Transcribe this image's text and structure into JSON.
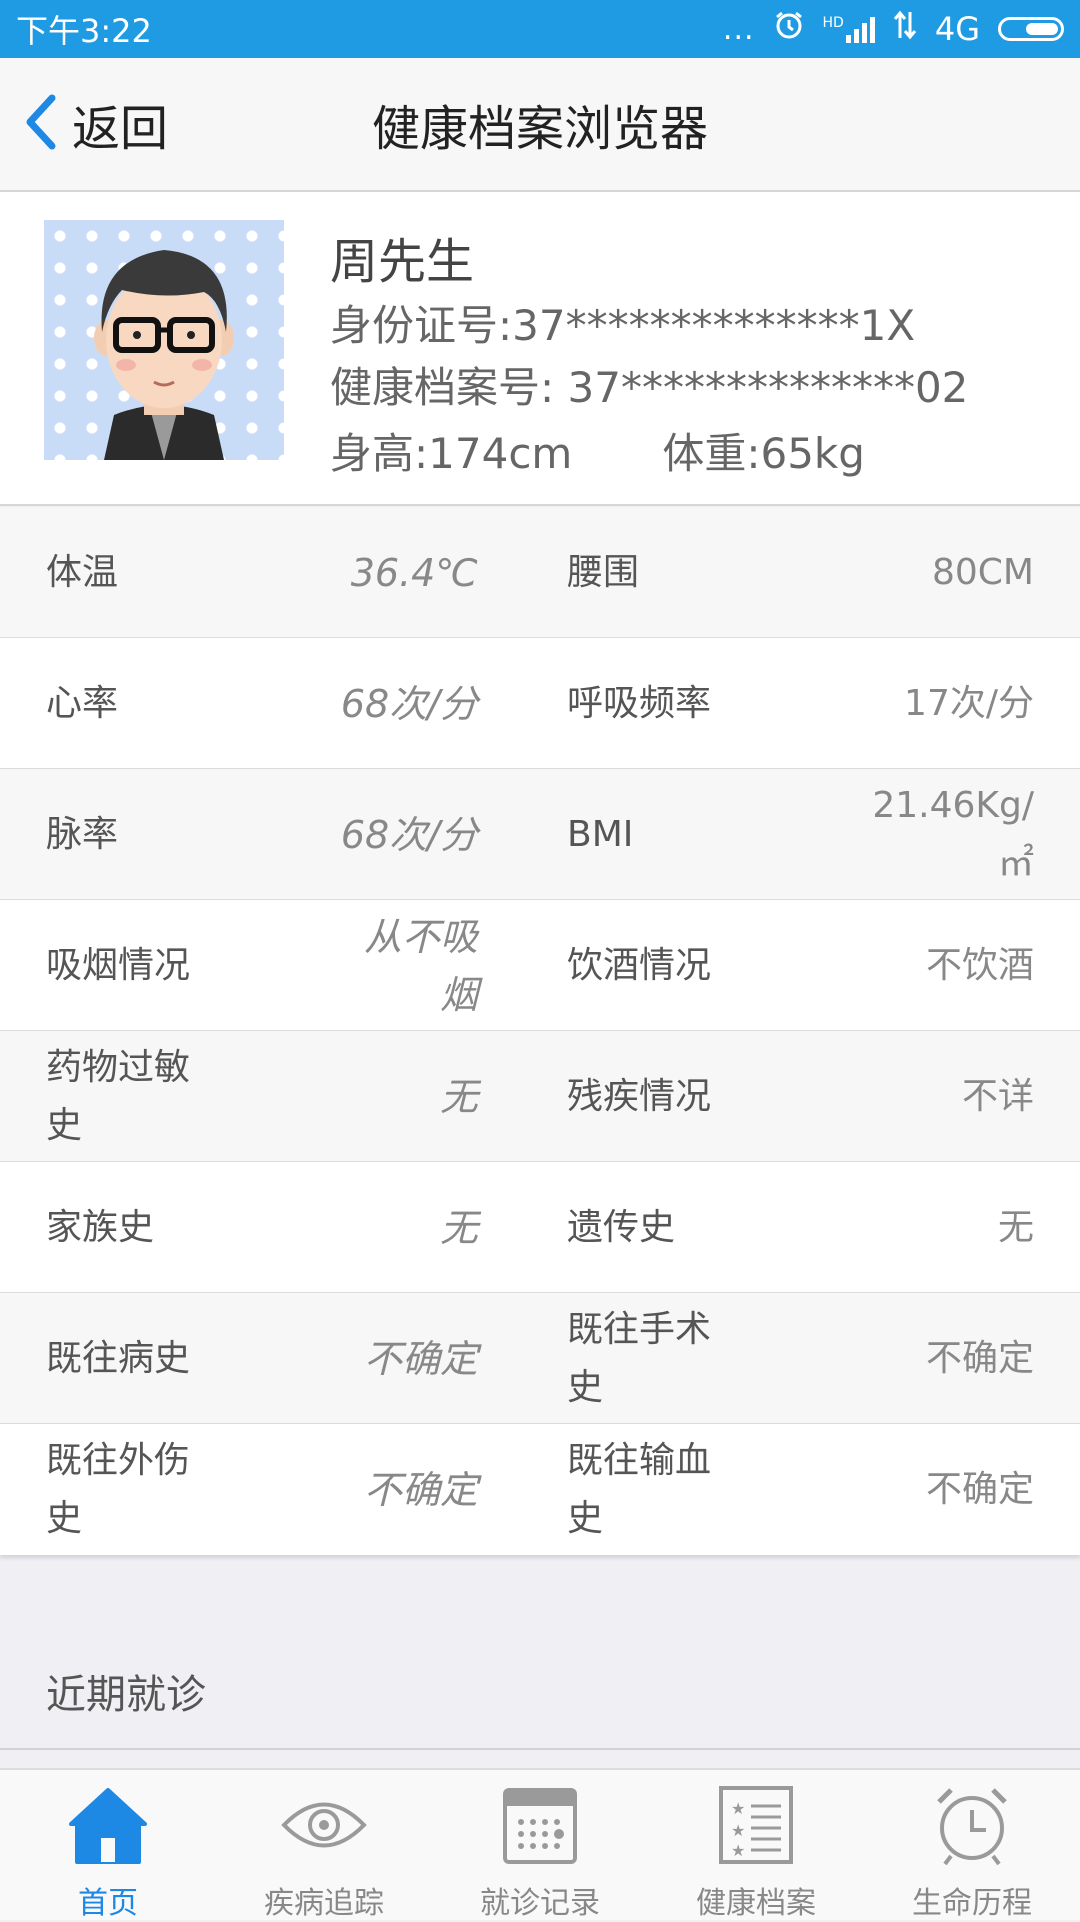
{
  "status_bar": {
    "time": "下午3:22",
    "dots": "...",
    "hd": "HD",
    "network": "4G"
  },
  "nav": {
    "back_label": "返回",
    "title": "健康档案浏览器"
  },
  "profile": {
    "name": "周先生",
    "id_number": "身份证号:37**************1X",
    "record_number": "健康档案号: 37**************02",
    "height": "身高:174cm",
    "weight": "体重:65kg"
  },
  "indicators": [
    {
      "label1": "体温",
      "value1": "36.4℃",
      "label2": "腰围",
      "value2": "80CM"
    },
    {
      "label1": "心率",
      "value1": "68次/分",
      "label2": "呼吸频率",
      "value2": "17次/分"
    },
    {
      "label1": "脉率",
      "value1": "68次/分",
      "label2": "BMI",
      "value2": "21.46Kg/㎡"
    },
    {
      "label1": "吸烟情况",
      "value1": "从不吸烟",
      "label2": "饮酒情况",
      "value2": "不饮酒"
    },
    {
      "label1": "药物过敏史",
      "value1": "无",
      "label2": "残疾情况",
      "value2": "不详"
    },
    {
      "label1": "家族史",
      "value1": "无",
      "label2": "遗传史",
      "value2": "无"
    },
    {
      "label1": "既往病史",
      "value1": "不确定",
      "label2": "既往手术史",
      "value2": "不确定"
    },
    {
      "label1": "既往外伤史",
      "value1": "不确定",
      "label2": "既往输血史",
      "value2": "不确定"
    }
  ],
  "recent_visits": {
    "title": "近期就诊"
  },
  "tabs": [
    {
      "label": "首页",
      "icon": "home-icon",
      "active": true
    },
    {
      "label": "疾病追踪",
      "icon": "eye-icon",
      "active": false
    },
    {
      "label": "就诊记录",
      "icon": "calendar-icon",
      "active": false
    },
    {
      "label": "健康档案",
      "icon": "list-icon",
      "active": false
    },
    {
      "label": "生命历程",
      "icon": "alarm-clock-icon",
      "active": false
    }
  ],
  "colors": {
    "status_bar": "#1e9be3",
    "accent": "#1e88e5",
    "inactive_icon": "#9a9a9a"
  }
}
